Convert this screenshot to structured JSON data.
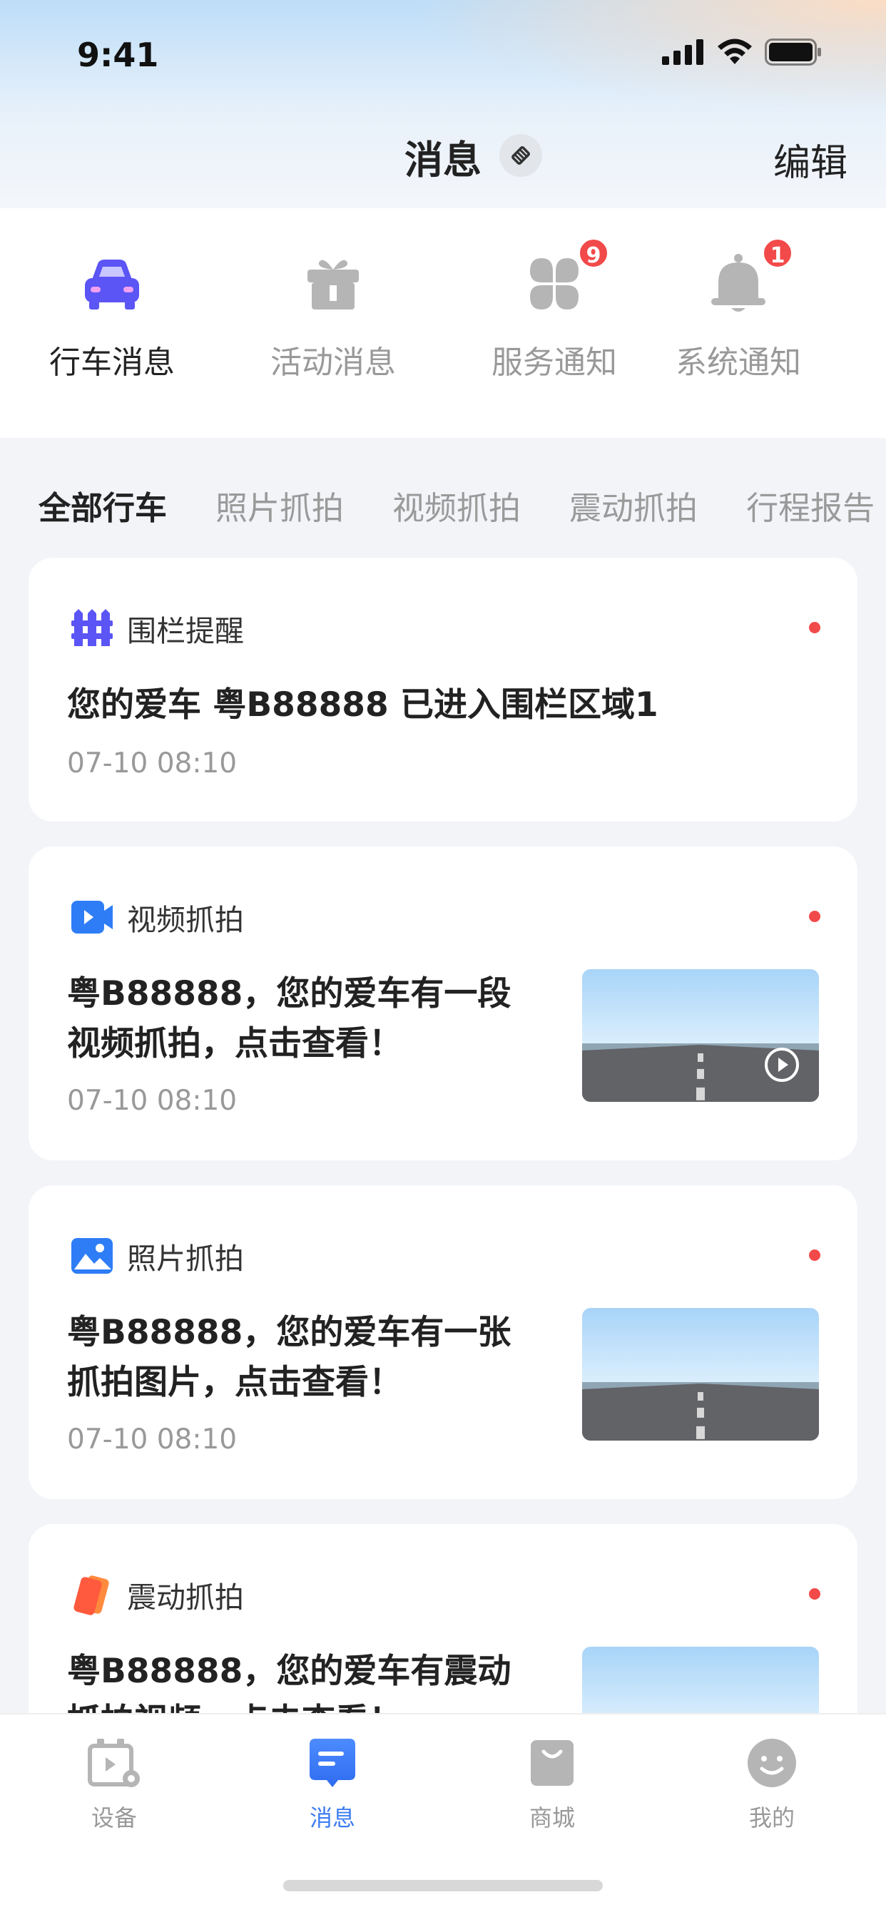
{
  "status_bar": {
    "time": "9:41"
  },
  "nav": {
    "title": "消息",
    "edit_label": "编辑"
  },
  "categories": [
    {
      "label": "行车消息",
      "icon": "car-icon",
      "active": true,
      "badge": ""
    },
    {
      "label": "活动消息",
      "icon": "gift-icon",
      "active": false,
      "badge": ""
    },
    {
      "label": "服务通知",
      "icon": "clover-icon",
      "active": false,
      "badge": "9"
    },
    {
      "label": "系统通知",
      "icon": "bell-icon",
      "active": false,
      "badge": "1"
    }
  ],
  "filter_tabs": [
    {
      "label": "全部行车",
      "active": true
    },
    {
      "label": "照片抓拍",
      "active": false
    },
    {
      "label": "视频抓拍",
      "active": false
    },
    {
      "label": "震动抓拍",
      "active": false
    },
    {
      "label": "行程报告",
      "active": false
    }
  ],
  "messages": [
    {
      "type_label": "围栏提醒",
      "icon": "fence-icon",
      "text_line1": "您的爱车 粤B88888 已进入围栏区域1",
      "text_line2": "",
      "time": "07-10  08:10",
      "unread": true,
      "thumbnail": "none"
    },
    {
      "type_label": "视频抓拍",
      "icon": "video-icon",
      "text_line1": "粤B88888，您的爱车有一段",
      "text_line2": "视频抓拍，点击查看！",
      "time": "07-10  08:10",
      "unread": true,
      "thumbnail": "video"
    },
    {
      "type_label": "照片抓拍",
      "icon": "photo-icon",
      "text_line1": "粤B88888，您的爱车有一张",
      "text_line2": "抓拍图片，点击查看！",
      "time": "07-10  08:10",
      "unread": true,
      "thumbnail": "photo"
    },
    {
      "type_label": "震动抓拍",
      "icon": "vibration-icon",
      "text_line1": "粤B88888，您的爱车有震动",
      "text_line2": "抓拍视频，点击查看！",
      "time": "",
      "unread": true,
      "thumbnail": "video"
    }
  ],
  "tabbar": [
    {
      "label": "设备",
      "icon": "device-icon",
      "active": false
    },
    {
      "label": "消息",
      "icon": "message-icon",
      "active": true
    },
    {
      "label": "商城",
      "icon": "shop-bag-icon",
      "active": false
    },
    {
      "label": "我的",
      "icon": "smiley-icon",
      "active": false
    }
  ],
  "colors": {
    "accent": "#3D7CF0",
    "brand_purple": "#5B55F5",
    "badge_red": "#F24A4A",
    "inactive_icon": "#B5B5B5"
  }
}
